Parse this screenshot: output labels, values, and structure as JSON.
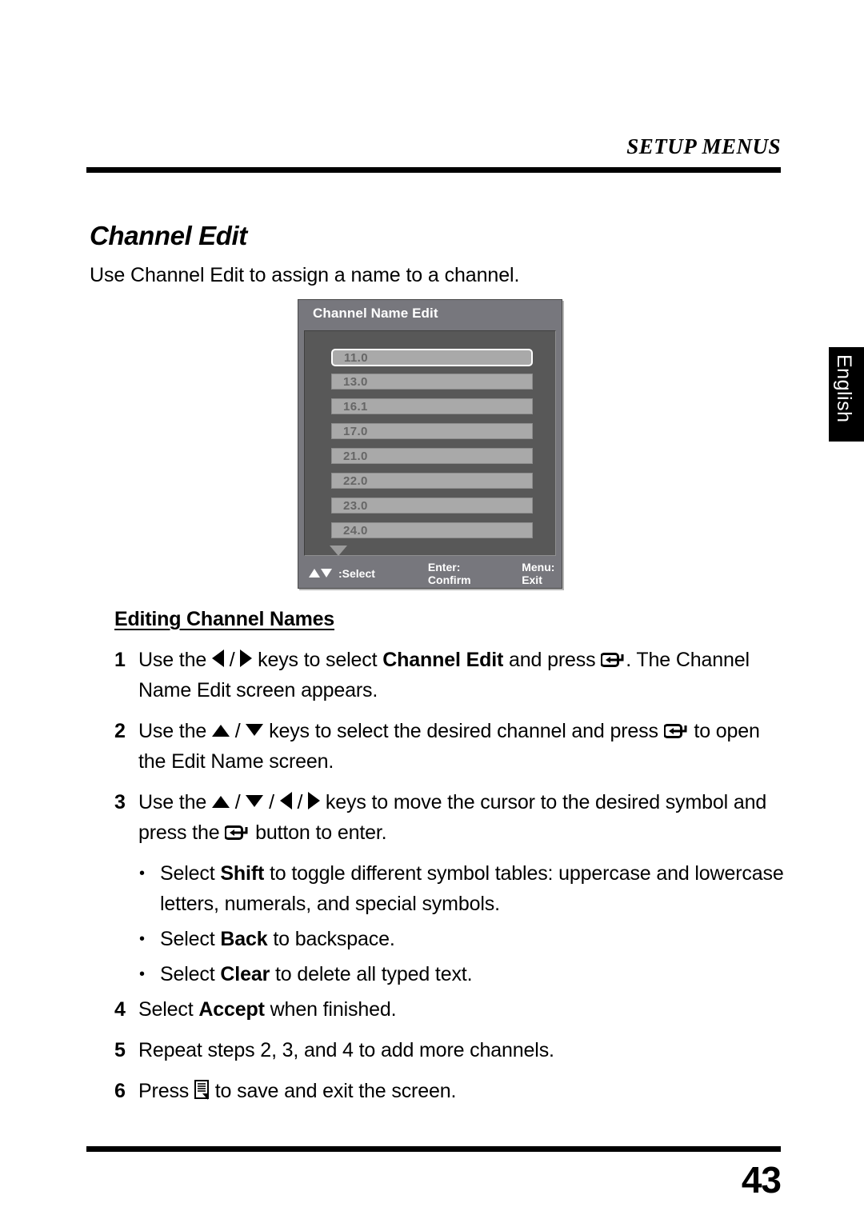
{
  "page": {
    "running_head": "SETUP MENUS",
    "number": "43",
    "language_tab": "English"
  },
  "section": {
    "title": "Channel Edit",
    "intro": "Use Channel Edit to assign a name to a channel.",
    "sub_heading": "Editing Channel Names"
  },
  "osd": {
    "title": "Channel Name Edit",
    "channels": [
      "11.0",
      "13.0",
      "16.1",
      "17.0",
      "21.0",
      "22.0",
      "23.0",
      "24.0"
    ],
    "selected_index": 0,
    "scroll_more_indicator": "down-arrow",
    "footer": {
      "select": ":Select",
      "confirm": "Enter: Confirm",
      "exit": "Menu: Exit"
    },
    "colors": {
      "title_bar": "#77777d",
      "body": "#585858",
      "item": "#a9a9a9",
      "item_text": "#666666",
      "highlight_border": "#ffffff"
    }
  },
  "steps": [
    {
      "num": "1",
      "parts": [
        {
          "t": "text",
          "v": "Use the "
        },
        {
          "t": "icon",
          "v": "left-arrow-icon"
        },
        {
          "t": "text",
          "v": " / "
        },
        {
          "t": "icon",
          "v": "right-arrow-icon"
        },
        {
          "t": "text",
          "v": " keys to select "
        },
        {
          "t": "bold",
          "v": "Channel Edit"
        },
        {
          "t": "text",
          "v": " and press "
        },
        {
          "t": "icon",
          "v": "enter-button-icon"
        },
        {
          "t": "text",
          "v": ". The Channel Name Edit screen appears."
        }
      ],
      "plain": "Use the ◀ / ▶ keys to select Channel Edit and press ⏎. The Channel Name Edit screen appears."
    },
    {
      "num": "2",
      "plain": "Use the ▲ / ▼ keys to select the desired channel and press ⏎ to open the Edit Name screen."
    },
    {
      "num": "3",
      "plain": "Use the ▲ / ▼ / ◀ / ▶ keys to move the cursor to the desired symbol and press the ⏎ button to enter."
    },
    {
      "num": "4",
      "plain": "Select Accept when finished."
    },
    {
      "num": "5",
      "plain": "Repeat steps 2, 3, and 4 to add more channels."
    },
    {
      "num": "6",
      "plain": "Press ☰ to save and exit the screen."
    }
  ],
  "step_text": {
    "s1_a": "Use the ",
    "s1_b": " / ",
    "s1_c": " keys to select ",
    "s1_bold": "Channel Edit",
    "s1_d": " and press ",
    "s1_e": ". The Channel Name Edit screen appears.",
    "s2_a": "Use the ",
    "s2_b": " / ",
    "s2_c": " keys to select the desired channel and press ",
    "s2_d": " to open the Edit Name screen.",
    "s3_a": "Use the ",
    "s3_b": " / ",
    "s3_c": " / ",
    "s3_d": " / ",
    "s3_e": " keys to move the cursor to the desired symbol and press the ",
    "s3_f": " button to enter.",
    "s4_a": "Select ",
    "s4_bold": "Accept",
    "s4_b": " when finished.",
    "s5_a": "Repeat steps 2, 3, and 4 to add more channels.",
    "s6_a": "Press ",
    "s6_b": " to save and exit the screen."
  },
  "bullets": [
    {
      "dot": "•",
      "a": "Select ",
      "bold": "Shift",
      "b": " to toggle different symbol tables: uppercase and lowercase letters, numerals, and special symbols."
    },
    {
      "dot": "•",
      "a": "Select ",
      "bold": "Back",
      "b": " to backspace."
    },
    {
      "dot": "•",
      "a": "Select ",
      "bold": "Clear",
      "b": " to delete all typed text."
    }
  ]
}
